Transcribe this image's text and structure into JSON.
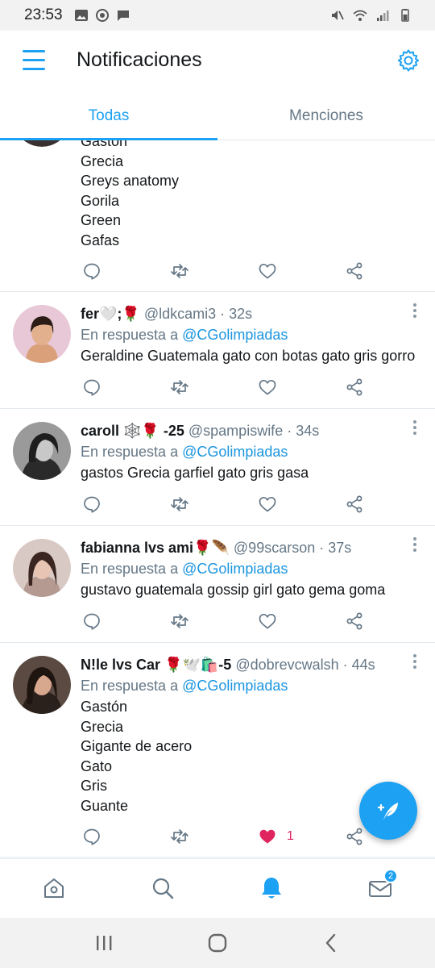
{
  "status_bar": {
    "time": "23:53",
    "left_icons": [
      "gallery-icon",
      "whatsapp-icon",
      "message-icon"
    ],
    "right_icons": [
      "mute-icon",
      "wifi-icon",
      "signal-icon",
      "battery-icon"
    ]
  },
  "header": {
    "title": "Notificaciones",
    "menu_icon": "hamburger-menu-icon",
    "settings_icon": "gear-icon"
  },
  "tabs": [
    {
      "label": "Todas",
      "active": true
    },
    {
      "label": "Menciones",
      "active": false
    }
  ],
  "tweets": [
    {
      "name": "",
      "handle": "",
      "time": "",
      "reply_prefix": "",
      "reply_mention": "",
      "text": "Gastón\nGrecia\nGreys anatomy\nGorila\nGreen\nGafas",
      "likes": ""
    },
    {
      "name": "fer🤍;🌹",
      "handle": "@ldkcami3 · 32s",
      "reply_prefix": "En respuesta a ",
      "reply_mention": "@CGolimpiadas",
      "text": "Geraldine Guatemala gato con botas gato gris gorro",
      "likes": ""
    },
    {
      "name": "caroll 🕸️🌹 -25",
      "handle": "@spampiswife · 34s",
      "reply_prefix": "En respuesta a ",
      "reply_mention": "@CGolimpiadas",
      "text": "gastos Grecia garfiel gato gris gasa",
      "likes": ""
    },
    {
      "name": "fabianna lvs ami🌹🪶",
      "handle": "@99scarson · 37s",
      "reply_prefix": "En respuesta a ",
      "reply_mention": "@CGolimpiadas",
      "text": "gustavo guatemala gossip girl gato gema goma",
      "likes": ""
    },
    {
      "name": "N!le lvs Car 🌹🕊️🛍️-5",
      "handle": "@dobrevcwalsh · 44s",
      "reply_prefix": "En respuesta a ",
      "reply_mention": "@CGolimpiadas",
      "text": "Gastón\nGrecia\nGigante de acero\nGato\nGris\nGuante",
      "likes": "1",
      "liked": true
    }
  ],
  "fab": {
    "icon": "compose-tweet-icon"
  },
  "bottom_nav": {
    "items": [
      "home-icon",
      "search-icon",
      "notifications-bell-icon",
      "messages-envelope-icon"
    ],
    "active": "notifications-bell-icon",
    "messages_badge": "2"
  },
  "system_nav": [
    "recent-apps-icon",
    "home-circle-icon",
    "back-icon"
  ],
  "colors": {
    "accent": "#1da1f2",
    "text": "#14171a",
    "muted": "#657786",
    "like": "#e0245e",
    "divider": "#e1e8ed"
  }
}
